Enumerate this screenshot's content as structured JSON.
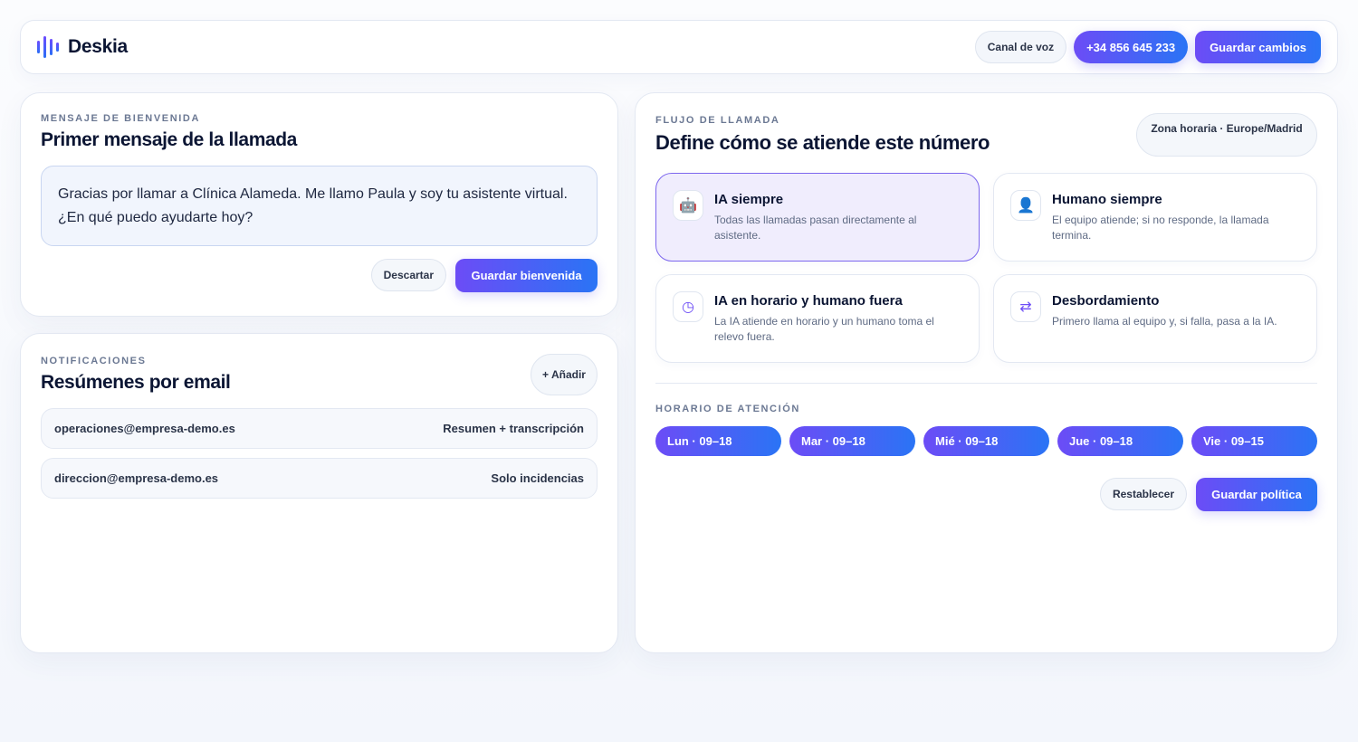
{
  "app": {
    "name": "Deskia"
  },
  "header": {
    "voice_channel_label": "Canal de voz",
    "phone_number": "+34 856 645 233",
    "save_changes_label": "Guardar cambios"
  },
  "welcome": {
    "eyebrow": "MENSAJE DE BIENVENIDA",
    "title": "Primer mensaje de la llamada",
    "message": "Gracias por llamar a Clínica Alameda. Me llamo Paula y soy tu asistente virtual. ¿En qué puedo ayudarte hoy?",
    "discard_label": "Descartar",
    "save_label": "Guardar bienvenida"
  },
  "notifications": {
    "eyebrow": "NOTIFICACIONES",
    "title": "Resúmenes por email",
    "add_label": "+ Añadir",
    "rows": [
      {
        "email": "operaciones@empresa-demo.es",
        "type": "Resumen + transcripción"
      },
      {
        "email": "direccion@empresa-demo.es",
        "type": "Solo incidencias"
      }
    ]
  },
  "flow": {
    "eyebrow": "FLUJO DE LLAMADA",
    "title": "Define cómo se atiende este número",
    "timezone": "Zona horaria · Europe/Madrid",
    "options": [
      {
        "icon": "robot-icon",
        "glyph": "🤖",
        "title": "IA siempre",
        "desc": "Todas las llamadas pasan directamente al asistente.",
        "selected": true
      },
      {
        "icon": "person-icon",
        "glyph": "👤",
        "title": "Humano siempre",
        "desc": "El equipo atiende; si no responde, la llamada termina.",
        "selected": false
      },
      {
        "icon": "clock-icon",
        "glyph": "◷",
        "title": "IA en horario y humano fuera",
        "desc": "La IA atiende en horario y un humano toma el relevo fuera.",
        "selected": false
      },
      {
        "icon": "swap-icon",
        "glyph": "⇄",
        "title": "Desbordamiento",
        "desc": "Primero llama al equipo y, si falla, pasa a la IA.",
        "selected": false
      }
    ],
    "hours_eyebrow": "HORARIO DE ATENCIÓN",
    "days": [
      "Lun · 09–18",
      "Mar · 09–18",
      "Mié · 09–18",
      "Jue · 09–18",
      "Vie · 09–15"
    ],
    "reset_label": "Restablecer",
    "save_policy_label": "Guardar política"
  }
}
